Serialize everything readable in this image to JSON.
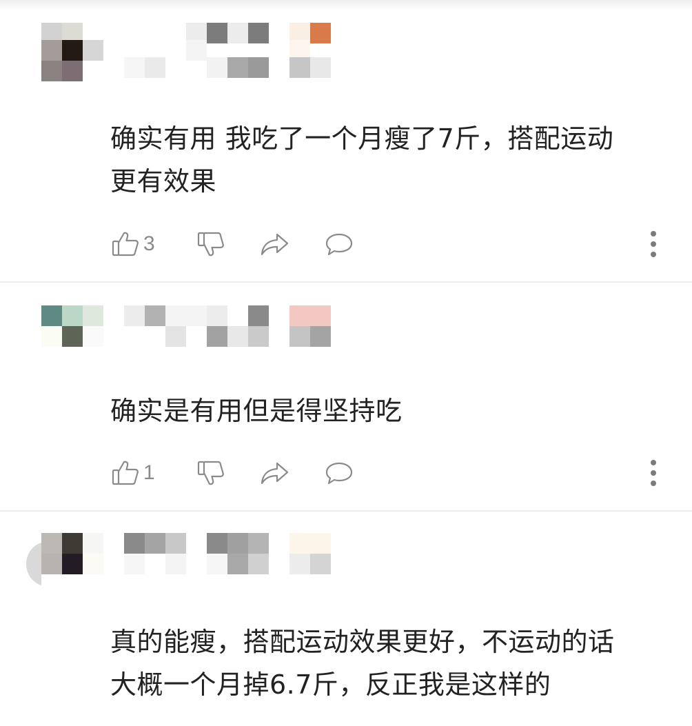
{
  "comments": [
    {
      "text_line1": "确实有用 我吃了一个月瘦了7斤，搭配运动",
      "text_line2": "更有效果",
      "like_count": "3"
    },
    {
      "text_line1": "确实是有用但是得坚持吃",
      "like_count": "1"
    },
    {
      "text_line1": "真的能瘦，搭配运动效果更好，不运动的话",
      "text_line2": "大概一个月掉6.7斤，反正我是这样的"
    }
  ],
  "icons": {
    "like": "thumb-up-icon",
    "dislike": "thumb-down-icon",
    "share": "share-arrow-icon",
    "reply": "comment-bubble-icon",
    "more": "more-vertical-icon"
  },
  "colors": {
    "text": "#222222",
    "icon": "#8a8a8a",
    "divider": "#ececec"
  }
}
